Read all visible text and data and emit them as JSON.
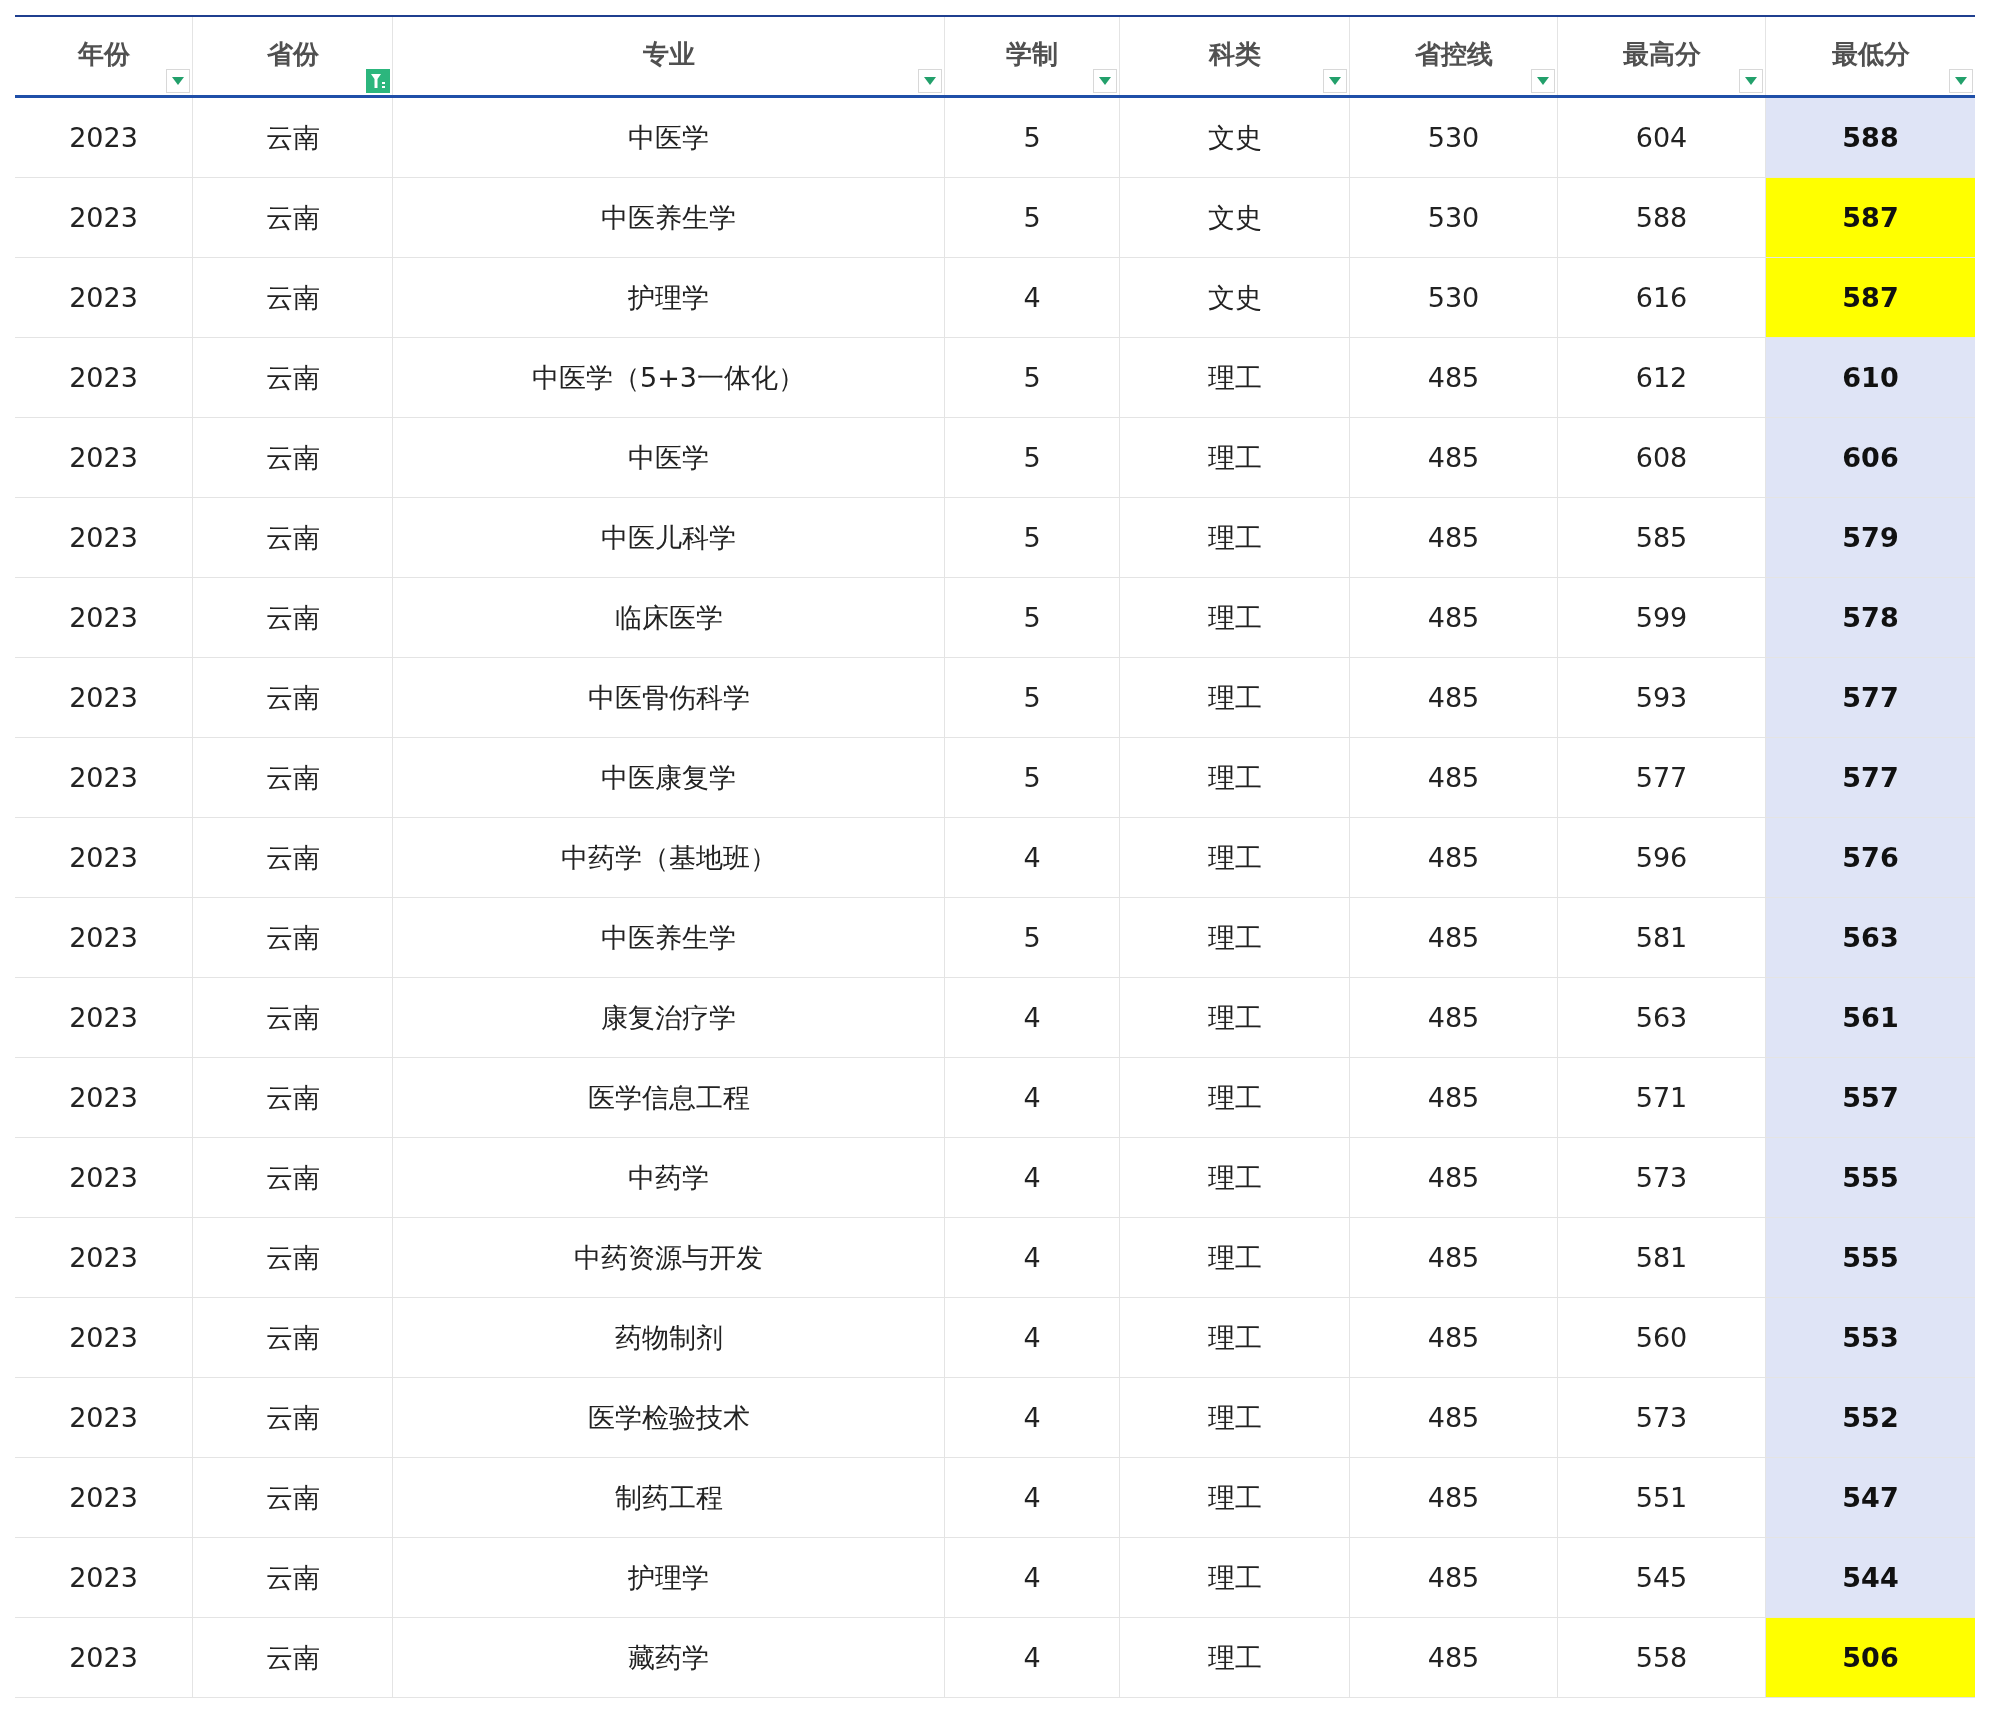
{
  "table": {
    "columns": [
      {
        "label": "年份",
        "filter_active": false
      },
      {
        "label": "省份",
        "filter_active": true
      },
      {
        "label": "专业",
        "filter_active": false
      },
      {
        "label": "学制",
        "filter_active": false
      },
      {
        "label": "科类",
        "filter_active": false
      },
      {
        "label": "省控线",
        "filter_active": false
      },
      {
        "label": "最高分",
        "filter_active": false
      },
      {
        "label": "最低分",
        "filter_active": false
      }
    ],
    "rows": [
      {
        "cells": [
          "2023",
          "云南",
          "中医学",
          "5",
          "文史",
          "530",
          "604",
          "588"
        ],
        "highlighted": false
      },
      {
        "cells": [
          "2023",
          "云南",
          "中医养生学",
          "5",
          "文史",
          "530",
          "588",
          "587"
        ],
        "highlighted": true
      },
      {
        "cells": [
          "2023",
          "云南",
          "护理学",
          "4",
          "文史",
          "530",
          "616",
          "587"
        ],
        "highlighted": true
      },
      {
        "cells": [
          "2023",
          "云南",
          "中医学（5+3一体化）",
          "5",
          "理工",
          "485",
          "612",
          "610"
        ],
        "highlighted": false
      },
      {
        "cells": [
          "2023",
          "云南",
          "中医学",
          "5",
          "理工",
          "485",
          "608",
          "606"
        ],
        "highlighted": false
      },
      {
        "cells": [
          "2023",
          "云南",
          "中医儿科学",
          "5",
          "理工",
          "485",
          "585",
          "579"
        ],
        "highlighted": false
      },
      {
        "cells": [
          "2023",
          "云南",
          "临床医学",
          "5",
          "理工",
          "485",
          "599",
          "578"
        ],
        "highlighted": false
      },
      {
        "cells": [
          "2023",
          "云南",
          "中医骨伤科学",
          "5",
          "理工",
          "485",
          "593",
          "577"
        ],
        "highlighted": false
      },
      {
        "cells": [
          "2023",
          "云南",
          "中医康复学",
          "5",
          "理工",
          "485",
          "577",
          "577"
        ],
        "highlighted": false
      },
      {
        "cells": [
          "2023",
          "云南",
          "中药学（基地班）",
          "4",
          "理工",
          "485",
          "596",
          "576"
        ],
        "highlighted": false
      },
      {
        "cells": [
          "2023",
          "云南",
          "中医养生学",
          "5",
          "理工",
          "485",
          "581",
          "563"
        ],
        "highlighted": false
      },
      {
        "cells": [
          "2023",
          "云南",
          "康复治疗学",
          "4",
          "理工",
          "485",
          "563",
          "561"
        ],
        "highlighted": false
      },
      {
        "cells": [
          "2023",
          "云南",
          "医学信息工程",
          "4",
          "理工",
          "485",
          "571",
          "557"
        ],
        "highlighted": false
      },
      {
        "cells": [
          "2023",
          "云南",
          "中药学",
          "4",
          "理工",
          "485",
          "573",
          "555"
        ],
        "highlighted": false
      },
      {
        "cells": [
          "2023",
          "云南",
          "中药资源与开发",
          "4",
          "理工",
          "485",
          "581",
          "555"
        ],
        "highlighted": false
      },
      {
        "cells": [
          "2023",
          "云南",
          "药物制剂",
          "4",
          "理工",
          "485",
          "560",
          "553"
        ],
        "highlighted": false
      },
      {
        "cells": [
          "2023",
          "云南",
          "医学检验技术",
          "4",
          "理工",
          "485",
          "573",
          "552"
        ],
        "highlighted": false
      },
      {
        "cells": [
          "2023",
          "云南",
          "制药工程",
          "4",
          "理工",
          "485",
          "551",
          "547"
        ],
        "highlighted": false
      },
      {
        "cells": [
          "2023",
          "云南",
          "护理学",
          "4",
          "理工",
          "485",
          "545",
          "544"
        ],
        "highlighted": false
      },
      {
        "cells": [
          "2023",
          "云南",
          "藏药学",
          "4",
          "理工",
          "485",
          "558",
          "506"
        ],
        "highlighted": true
      }
    ]
  }
}
